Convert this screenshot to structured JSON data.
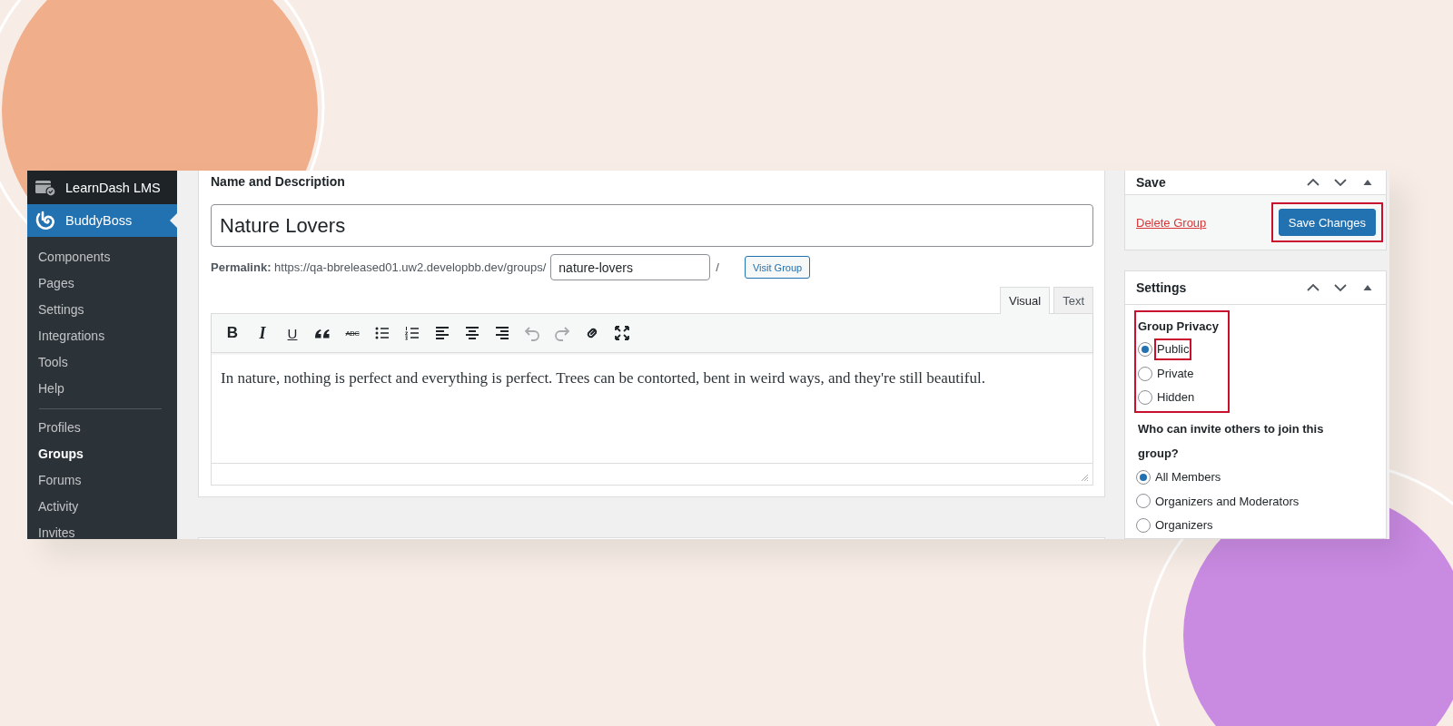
{
  "sidebar": {
    "menu": [
      {
        "label": "LearnDash LMS",
        "selected": false
      },
      {
        "label": "BuddyBoss",
        "selected": true
      }
    ],
    "submenu": [
      [
        {
          "label": "Components",
          "selected": false
        },
        {
          "label": "Pages",
          "selected": false
        },
        {
          "label": "Settings",
          "selected": false
        },
        {
          "label": "Integrations",
          "selected": false
        },
        {
          "label": "Tools",
          "selected": false
        },
        {
          "label": "Help",
          "selected": false
        }
      ],
      [
        {
          "label": "Profiles",
          "selected": false
        },
        {
          "label": "Groups",
          "selected": true
        },
        {
          "label": "Forums",
          "selected": false
        },
        {
          "label": "Activity",
          "selected": false
        },
        {
          "label": "Invites",
          "selected": false
        }
      ]
    ]
  },
  "editor_card": {
    "title": "Name and Description",
    "name_field": {
      "value": "Nature Lovers"
    },
    "permalink": "**Permalink:** https://qa-bbreleased01.uw2.developbb.dev/groups/",
    "slug_field": {
      "value": "nature-lovers"
    },
    "slug_suffix": "/",
    "visit_button": "Visit Group",
    "tabs": [
      {
        "label": "Visual",
        "selected": true
      },
      {
        "label": "Text",
        "selected": false
      }
    ],
    "toolbar": [
      {
        "kind": "bold",
        "label": "B",
        "disabled": false
      },
      {
        "kind": "italic",
        "label": "I",
        "disabled": false
      },
      {
        "kind": "underline",
        "label": "U",
        "disabled": false
      },
      {
        "kind": "quote",
        "disabled": false
      },
      {
        "kind": "strike",
        "label": "ABC",
        "disabled": false
      },
      {
        "kind": "bullets",
        "disabled": false
      },
      {
        "kind": "numbers",
        "disabled": false
      },
      {
        "kind": "align-left",
        "disabled": false
      },
      {
        "kind": "align-center",
        "disabled": false
      },
      {
        "kind": "align-right",
        "disabled": false
      },
      {
        "kind": "undo",
        "disabled": true
      },
      {
        "kind": "redo",
        "disabled": true
      },
      {
        "kind": "link",
        "disabled": false
      },
      {
        "kind": "fullscreen",
        "disabled": false
      }
    ],
    "content": "In nature, nothing is perfect and everything is perfect. Trees can be contorted, bent in weird ways, and they're still beautiful."
  },
  "save_box": {
    "title": "Save",
    "delete_link": "Delete Group",
    "save_button": {
      "label": "Save Changes",
      "highlighted": true
    }
  },
  "settings_box": {
    "title": "Settings",
    "privacy": {
      "heading": "Group Privacy",
      "highlighted": true,
      "options": [
        {
          "label": "Public",
          "selected": true,
          "highlighted": true
        },
        {
          "label": "Private",
          "selected": false,
          "highlighted": false
        },
        {
          "label": "Hidden",
          "selected": false,
          "highlighted": false
        }
      ]
    },
    "invite": {
      "heading": "Who can invite others to join this group?",
      "options": [
        {
          "label": "All Members",
          "selected": true
        },
        {
          "label": "Organizers and Moderators",
          "selected": false
        },
        {
          "label": "Organizers",
          "selected": false
        }
      ]
    }
  }
}
